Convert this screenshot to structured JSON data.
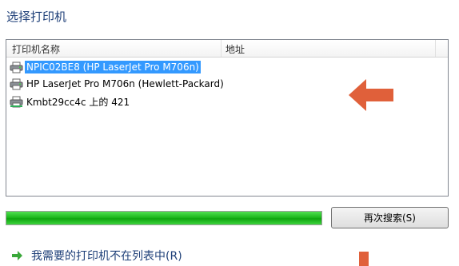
{
  "dialog": {
    "title": "选择打印机"
  },
  "printer_list": {
    "columns": [
      "打印机名称",
      "地址"
    ],
    "rows": [
      {
        "name": "NPIC02BE8 (HP LaserJet Pro M706n)",
        "selected": true,
        "icon": "printer-icon"
      },
      {
        "name": "HP LaserJet Pro M706n (Hewlett-Packard)",
        "selected": false,
        "icon": "printer-icon"
      },
      {
        "name": "Kmbt29cc4c 上的 421",
        "selected": false,
        "icon": "printer-icon"
      }
    ]
  },
  "progress": {
    "value": 1.0,
    "color": "#1db81d"
  },
  "buttons": {
    "search_again": "再次搜索(S)"
  },
  "links": {
    "not_listed": "我需要的打印机不在列表中(R)"
  },
  "annotations": {
    "arrow_color": "#e0603a"
  }
}
